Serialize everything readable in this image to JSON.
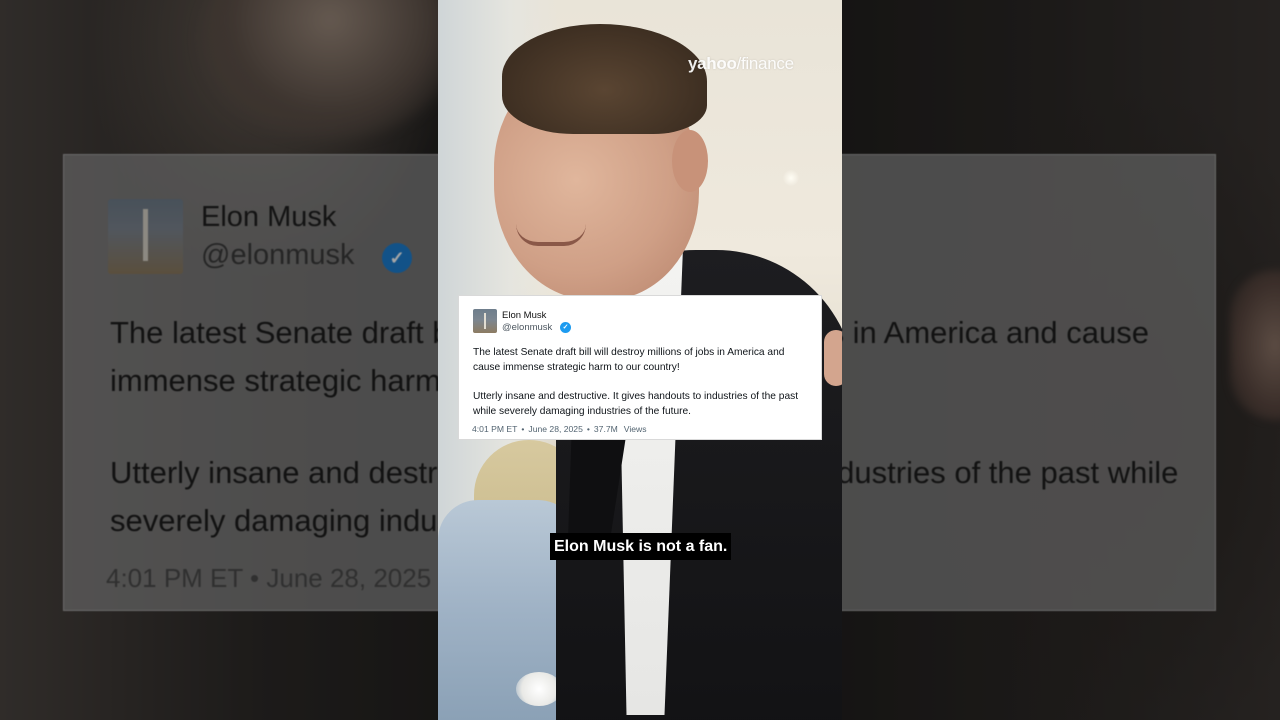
{
  "watermark": {
    "brand": "yahoo",
    "slash": "/",
    "section": "finance"
  },
  "tweet": {
    "author_name": "Elon Musk",
    "author_handle": "@elonmusk",
    "verified_icon": "verified-badge-icon",
    "verified_glyph": "✓",
    "paragraph_1": "The latest Senate draft bill will destroy millions of jobs in America and cause immense strategic harm to our country!",
    "paragraph_2": "Utterly insane and destructive. It gives handouts to industries of the past while severely damaging industries of the future.",
    "time": "4:01 PM ET",
    "separator": "•",
    "date": "June 28, 2025",
    "views_count": "37.7M",
    "views_label": "Views"
  },
  "background_tweet": {
    "author_name": "Elon Musk",
    "author_handle": "@elonmusk",
    "paragraph_1": "The latest Senate draft bill will destroy millions of jobs in America and cause immense strategic harm to our country!",
    "paragraph_2": "Utterly insane and destructive. It gives handouts to industries of the past while severely damaging industries of the future.",
    "meta": "4:01 PM ET • June 28, 2025"
  },
  "caption": {
    "text": "Elon Musk is not a fan."
  },
  "colors": {
    "verified_blue": "#1d9bf0",
    "caption_bg": "#000000",
    "caption_text": "#ffffff"
  }
}
